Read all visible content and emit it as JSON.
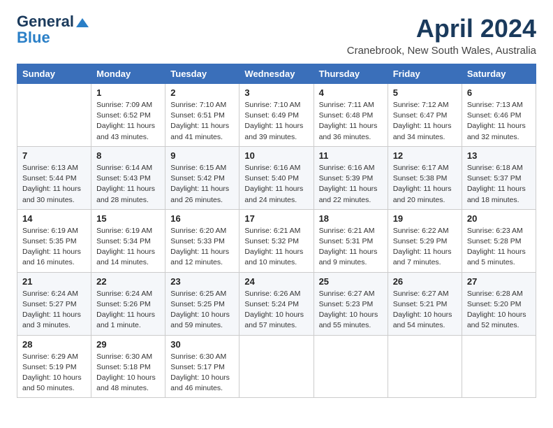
{
  "logo": {
    "line1": "General",
    "line2": "Blue"
  },
  "title": "April 2024",
  "location": "Cranebrook, New South Wales, Australia",
  "days_header": [
    "Sunday",
    "Monday",
    "Tuesday",
    "Wednesday",
    "Thursday",
    "Friday",
    "Saturday"
  ],
  "weeks": [
    [
      {
        "day": "",
        "info": ""
      },
      {
        "day": "1",
        "info": "Sunrise: 7:09 AM\nSunset: 6:52 PM\nDaylight: 11 hours\nand 43 minutes."
      },
      {
        "day": "2",
        "info": "Sunrise: 7:10 AM\nSunset: 6:51 PM\nDaylight: 11 hours\nand 41 minutes."
      },
      {
        "day": "3",
        "info": "Sunrise: 7:10 AM\nSunset: 6:49 PM\nDaylight: 11 hours\nand 39 minutes."
      },
      {
        "day": "4",
        "info": "Sunrise: 7:11 AM\nSunset: 6:48 PM\nDaylight: 11 hours\nand 36 minutes."
      },
      {
        "day": "5",
        "info": "Sunrise: 7:12 AM\nSunset: 6:47 PM\nDaylight: 11 hours\nand 34 minutes."
      },
      {
        "day": "6",
        "info": "Sunrise: 7:13 AM\nSunset: 6:46 PM\nDaylight: 11 hours\nand 32 minutes."
      }
    ],
    [
      {
        "day": "7",
        "info": "Sunrise: 6:13 AM\nSunset: 5:44 PM\nDaylight: 11 hours\nand 30 minutes."
      },
      {
        "day": "8",
        "info": "Sunrise: 6:14 AM\nSunset: 5:43 PM\nDaylight: 11 hours\nand 28 minutes."
      },
      {
        "day": "9",
        "info": "Sunrise: 6:15 AM\nSunset: 5:42 PM\nDaylight: 11 hours\nand 26 minutes."
      },
      {
        "day": "10",
        "info": "Sunrise: 6:16 AM\nSunset: 5:40 PM\nDaylight: 11 hours\nand 24 minutes."
      },
      {
        "day": "11",
        "info": "Sunrise: 6:16 AM\nSunset: 5:39 PM\nDaylight: 11 hours\nand 22 minutes."
      },
      {
        "day": "12",
        "info": "Sunrise: 6:17 AM\nSunset: 5:38 PM\nDaylight: 11 hours\nand 20 minutes."
      },
      {
        "day": "13",
        "info": "Sunrise: 6:18 AM\nSunset: 5:37 PM\nDaylight: 11 hours\nand 18 minutes."
      }
    ],
    [
      {
        "day": "14",
        "info": "Sunrise: 6:19 AM\nSunset: 5:35 PM\nDaylight: 11 hours\nand 16 minutes."
      },
      {
        "day": "15",
        "info": "Sunrise: 6:19 AM\nSunset: 5:34 PM\nDaylight: 11 hours\nand 14 minutes."
      },
      {
        "day": "16",
        "info": "Sunrise: 6:20 AM\nSunset: 5:33 PM\nDaylight: 11 hours\nand 12 minutes."
      },
      {
        "day": "17",
        "info": "Sunrise: 6:21 AM\nSunset: 5:32 PM\nDaylight: 11 hours\nand 10 minutes."
      },
      {
        "day": "18",
        "info": "Sunrise: 6:21 AM\nSunset: 5:31 PM\nDaylight: 11 hours\nand 9 minutes."
      },
      {
        "day": "19",
        "info": "Sunrise: 6:22 AM\nSunset: 5:29 PM\nDaylight: 11 hours\nand 7 minutes."
      },
      {
        "day": "20",
        "info": "Sunrise: 6:23 AM\nSunset: 5:28 PM\nDaylight: 11 hours\nand 5 minutes."
      }
    ],
    [
      {
        "day": "21",
        "info": "Sunrise: 6:24 AM\nSunset: 5:27 PM\nDaylight: 11 hours\nand 3 minutes."
      },
      {
        "day": "22",
        "info": "Sunrise: 6:24 AM\nSunset: 5:26 PM\nDaylight: 11 hours\nand 1 minute."
      },
      {
        "day": "23",
        "info": "Sunrise: 6:25 AM\nSunset: 5:25 PM\nDaylight: 10 hours\nand 59 minutes."
      },
      {
        "day": "24",
        "info": "Sunrise: 6:26 AM\nSunset: 5:24 PM\nDaylight: 10 hours\nand 57 minutes."
      },
      {
        "day": "25",
        "info": "Sunrise: 6:27 AM\nSunset: 5:23 PM\nDaylight: 10 hours\nand 55 minutes."
      },
      {
        "day": "26",
        "info": "Sunrise: 6:27 AM\nSunset: 5:21 PM\nDaylight: 10 hours\nand 54 minutes."
      },
      {
        "day": "27",
        "info": "Sunrise: 6:28 AM\nSunset: 5:20 PM\nDaylight: 10 hours\nand 52 minutes."
      }
    ],
    [
      {
        "day": "28",
        "info": "Sunrise: 6:29 AM\nSunset: 5:19 PM\nDaylight: 10 hours\nand 50 minutes."
      },
      {
        "day": "29",
        "info": "Sunrise: 6:30 AM\nSunset: 5:18 PM\nDaylight: 10 hours\nand 48 minutes."
      },
      {
        "day": "30",
        "info": "Sunrise: 6:30 AM\nSunset: 5:17 PM\nDaylight: 10 hours\nand 46 minutes."
      },
      {
        "day": "",
        "info": ""
      },
      {
        "day": "",
        "info": ""
      },
      {
        "day": "",
        "info": ""
      },
      {
        "day": "",
        "info": ""
      }
    ]
  ]
}
